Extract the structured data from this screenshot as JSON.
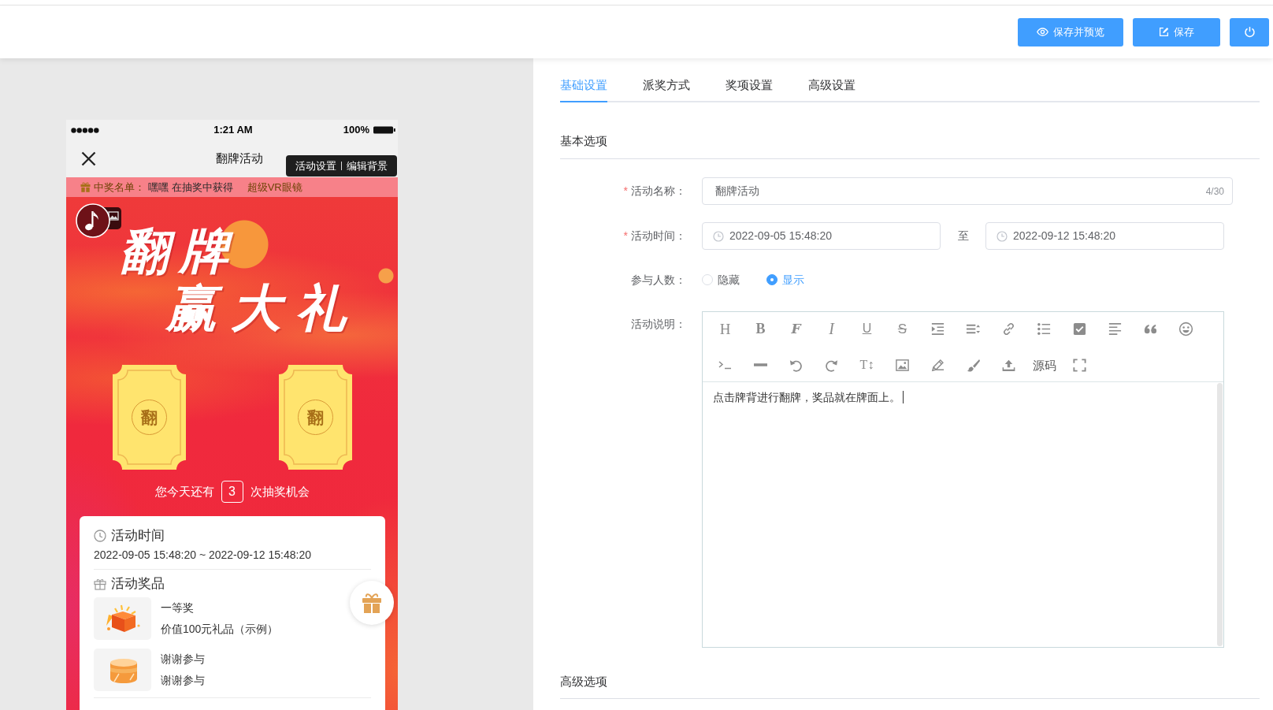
{
  "header": {
    "buttons": [
      {
        "kind": "preview",
        "label": "保存并预览"
      },
      {
        "kind": "save",
        "label": "保存"
      },
      {
        "kind": "power"
      }
    ]
  },
  "preview": {
    "status_bar": {
      "time": "1:21 AM",
      "battery": "100%"
    },
    "nav_bar": {
      "title": "翻牌活动"
    },
    "popup_menu": {
      "items": [
        "活动设置",
        "编辑背景"
      ]
    },
    "winner_ticker": {
      "label": "中奖名单：",
      "winner": "嘿嘿 在抽奖中获得",
      "prize": "超级VR眼镜"
    },
    "banner": {
      "headline": [
        "翻牌",
        "赢大礼"
      ]
    },
    "cards": [
      {
        "face": "翻"
      },
      {
        "face": "翻"
      }
    ],
    "chances": {
      "before": "您今天还有",
      "count": "3",
      "after": "次抽奖机会"
    },
    "info_card": {
      "time_title": "活动时间",
      "time_range": "2022-09-05 15:48:20 ~ 2022-09-12 15:48:20",
      "prizes_title": "活动奖品",
      "prizes": [
        {
          "kind": "gift_box",
          "name": "一等奖",
          "detail": "价值100元礼品（示例）"
        },
        {
          "kind": "drum",
          "name": "谢谢参与",
          "detail": "谢谢参与"
        }
      ]
    }
  },
  "settings": {
    "tabs": [
      {
        "label": "基础设置",
        "selected": true
      },
      {
        "label": "派奖方式",
        "selected": false
      },
      {
        "label": "奖项设置",
        "selected": false
      },
      {
        "label": "高级设置",
        "selected": false
      }
    ],
    "basic_section": {
      "title": "基本选项",
      "fields": [
        {
          "kind": "text",
          "required_mark": "*",
          "label": "活动名称：",
          "value": "翻牌活动",
          "counter": "4/30"
        },
        {
          "kind": "date_range",
          "required_mark": "*",
          "label": "活动时间：",
          "start": "2022-09-05 15:48:20",
          "separator": "至",
          "end": "2022-09-12 15:48:20"
        },
        {
          "kind": "radio",
          "label": "参与人数：",
          "options": [
            {
              "label": "隐藏",
              "selected": false
            },
            {
              "label": "显示",
              "selected": true
            }
          ]
        },
        {
          "kind": "editor",
          "label": "活动说明：",
          "toolbar": [
            {
              "kind": "heading",
              "glyph": "H"
            },
            {
              "kind": "bold",
              "glyph": "B"
            },
            {
              "kind": "font",
              "glyph": "F"
            },
            {
              "kind": "italic",
              "glyph": "I"
            },
            {
              "kind": "underline",
              "glyph": "U"
            },
            {
              "kind": "strike",
              "glyph": "S"
            },
            {
              "kind": "indent"
            },
            {
              "kind": "line_height"
            },
            {
              "kind": "link"
            },
            {
              "kind": "list"
            },
            {
              "kind": "checkbox"
            },
            {
              "kind": "align"
            },
            {
              "kind": "quote"
            },
            {
              "kind": "emoji"
            },
            {
              "kind": "code"
            },
            {
              "kind": "rule"
            },
            {
              "kind": "undo"
            },
            {
              "kind": "redo"
            },
            {
              "kind": "text_size",
              "glyph": "T↕"
            },
            {
              "kind": "image"
            },
            {
              "kind": "pencil"
            },
            {
              "kind": "brush"
            },
            {
              "kind": "upload"
            },
            {
              "kind": "source",
              "glyph": "源码"
            },
            {
              "kind": "fullscreen"
            }
          ],
          "content": "点击牌背进行翻牌，奖品就在牌面上。"
        }
      ]
    },
    "advanced_section": {
      "title": "高级选项"
    }
  }
}
